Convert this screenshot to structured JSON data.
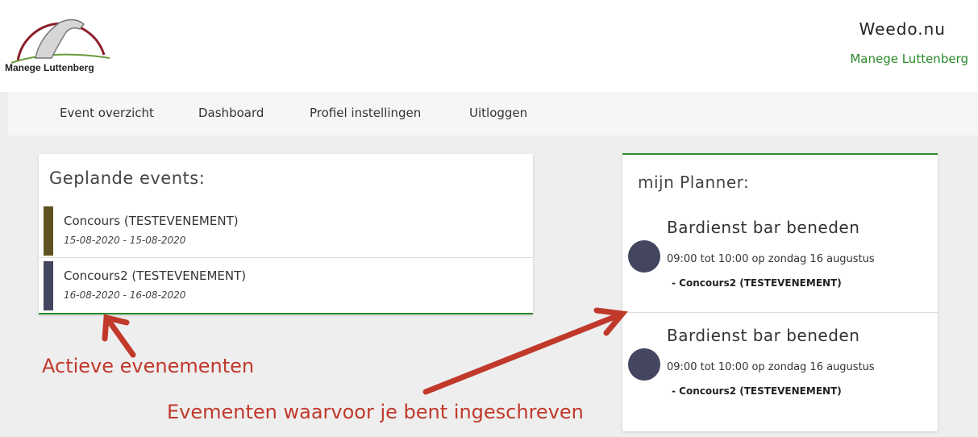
{
  "header": {
    "logo_text": "Manege Luttenberg",
    "site_title": "Weedo.nu",
    "site_subtitle": "Manege Luttenberg"
  },
  "nav": {
    "items": [
      {
        "label": "Event overzicht"
      },
      {
        "label": "Dashboard"
      },
      {
        "label": "Profiel instellingen"
      },
      {
        "label": "Uitloggen"
      }
    ]
  },
  "events": {
    "title": "Geplande events:",
    "items": [
      {
        "name": "Concours (TESTEVENEMENT)",
        "dates": "15-08-2020 - 15-08-2020",
        "color": "#5e5222"
      },
      {
        "name": "Concours2 (TESTEVENEMENT)",
        "dates": "16-08-2020 - 16-08-2020",
        "color": "#44455f"
      }
    ]
  },
  "planner": {
    "title": "mijn Planner:",
    "items": [
      {
        "title": "Bardienst bar beneden",
        "time": "09:00 tot 10:00 op zondag 16 augustus",
        "event": "Concours2 (TESTEVENEMENT)"
      },
      {
        "title": "Bardienst bar beneden",
        "time": "09:00 tot 10:00 op zondag 16 augustus",
        "event": "Concours2 (TESTEVENEMENT)"
      }
    ]
  },
  "annotations": {
    "active": "Actieve evenementen",
    "registered": "Evementen waarvoor je bent ingeschreven"
  },
  "colors": {
    "accent_green": "#2a8a2a",
    "annotation_red": "#c0392b",
    "dot": "#44455f"
  }
}
